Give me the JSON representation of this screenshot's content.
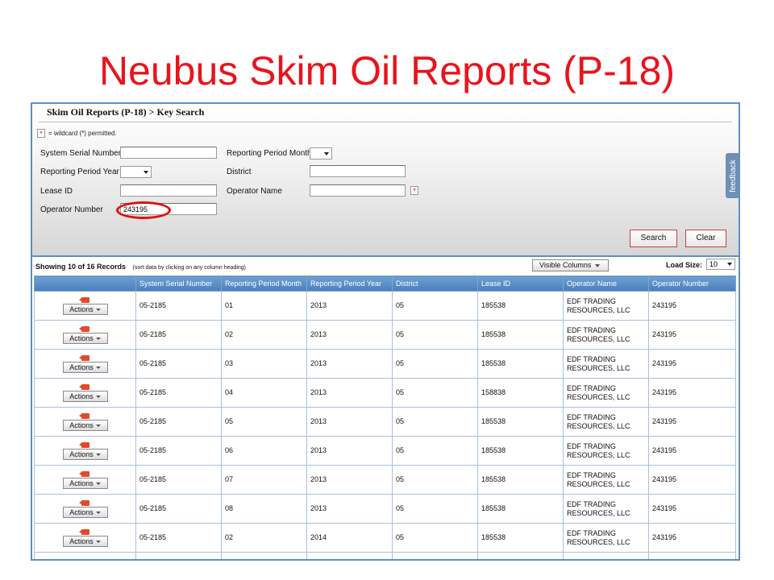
{
  "slide_title": "Neubus Skim Oil Reports (P-18)",
  "app": {
    "breadcrumb": "Skim Oil Reports (P-18) > Key Search",
    "wildcard_symbol": "*",
    "wildcard_note": "= wildcard (*) permitted.",
    "feedback_label": "feedback",
    "form": {
      "system_serial_number": {
        "label": "System Serial Number",
        "value": ""
      },
      "reporting_period_year": {
        "label": "Reporting Period Year",
        "value": ""
      },
      "lease_id": {
        "label": "Lease ID",
        "value": ""
      },
      "operator_number": {
        "label": "Operator Number",
        "value": "243195"
      },
      "reporting_period_month": {
        "label": "Reporting Period Month",
        "value": ""
      },
      "district": {
        "label": "District",
        "value": ""
      },
      "operator_name": {
        "label": "Operator Name",
        "value": ""
      }
    },
    "buttons": {
      "search": "Search",
      "clear": "Clear"
    },
    "results": {
      "showing": "Showing 10 of 16 Records",
      "sort_hint": "(sort data by clicking on any column heading)",
      "visible_columns": "Visible Columns",
      "load_size_label": "Load Size:",
      "load_size_value": "10",
      "actions_label": "Actions",
      "columns": [
        "",
        "System Serial Number",
        "Reporting Period Month",
        "Reporting Period Year",
        "District",
        "Lease ID",
        "Operator Name",
        "Operator Number"
      ],
      "rows": [
        {
          "serial": "05-2185",
          "month": "01",
          "year": "2013",
          "district": "05",
          "lease": "185538",
          "operator_name": "EDF TRADING RESOURCES, LLC",
          "operator_number": "243195"
        },
        {
          "serial": "05-2185",
          "month": "02",
          "year": "2013",
          "district": "05",
          "lease": "185538",
          "operator_name": "EDF TRADING RESOURCES, LLC",
          "operator_number": "243195"
        },
        {
          "serial": "05-2185",
          "month": "03",
          "year": "2013",
          "district": "05",
          "lease": "185538",
          "operator_name": "EDF TRADING RESOURCES, LLC",
          "operator_number": "243195"
        },
        {
          "serial": "05-2185",
          "month": "04",
          "year": "2013",
          "district": "05",
          "lease": "158838",
          "operator_name": "EDF TRADING RESOURCES, LLC",
          "operator_number": "243195"
        },
        {
          "serial": "05-2185",
          "month": "05",
          "year": "2013",
          "district": "05",
          "lease": "185538",
          "operator_name": "EDF TRADING RESOURCES, LLC",
          "operator_number": "243195"
        },
        {
          "serial": "05-2185",
          "month": "06",
          "year": "2013",
          "district": "05",
          "lease": "185538",
          "operator_name": "EDF TRADING RESOURCES, LLC",
          "operator_number": "243195"
        },
        {
          "serial": "05-2185",
          "month": "07",
          "year": "2013",
          "district": "05",
          "lease": "185538",
          "operator_name": "EDF TRADING RESOURCES, LLC",
          "operator_number": "243195"
        },
        {
          "serial": "05-2185",
          "month": "08",
          "year": "2013",
          "district": "05",
          "lease": "185538",
          "operator_name": "EDF TRADING RESOURCES, LLC",
          "operator_number": "243195"
        },
        {
          "serial": "05-2185",
          "month": "02",
          "year": "2014",
          "district": "05",
          "lease": "185538",
          "operator_name": "EDF TRADING RESOURCES, LLC",
          "operator_number": "243195"
        },
        {
          "serial": "",
          "month": "",
          "year": "",
          "district": "",
          "lease": "",
          "operator_name": "",
          "operator_number": ""
        }
      ]
    },
    "colors": {
      "title_red": "#e8141d",
      "border_blue": "#5e8fc3",
      "header_blue": "#4a7fbc",
      "highlight_red": "#e01010"
    }
  }
}
